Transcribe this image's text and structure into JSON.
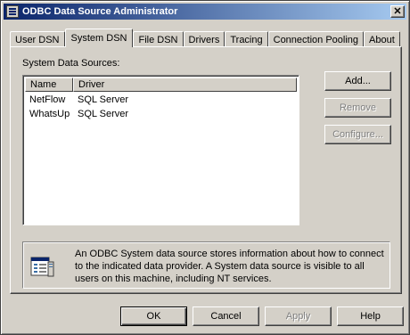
{
  "window": {
    "title": "ODBC Data Source Administrator",
    "close_label": "✕"
  },
  "tabs": [
    {
      "label": "User DSN",
      "active": false
    },
    {
      "label": "System DSN",
      "active": true
    },
    {
      "label": "File DSN",
      "active": false
    },
    {
      "label": "Drivers",
      "active": false
    },
    {
      "label": "Tracing",
      "active": false
    },
    {
      "label": "Connection Pooling",
      "active": false
    },
    {
      "label": "About",
      "active": false
    }
  ],
  "panel": {
    "list_label": "System Data Sources:",
    "columns": {
      "name": "Name",
      "driver": "Driver"
    },
    "rows": [
      {
        "name": "NetFlow",
        "driver": "SQL Server"
      },
      {
        "name": "WhatsUp",
        "driver": "SQL Server"
      }
    ],
    "buttons": {
      "add": "Add...",
      "remove": "Remove",
      "configure": "Configure..."
    },
    "info_text": "An ODBC System data source stores information about how to connect to the indicated data provider.  A System data source is visible to all users on this machine, including NT services."
  },
  "footer": {
    "ok": "OK",
    "cancel": "Cancel",
    "apply": "Apply",
    "help": "Help"
  }
}
